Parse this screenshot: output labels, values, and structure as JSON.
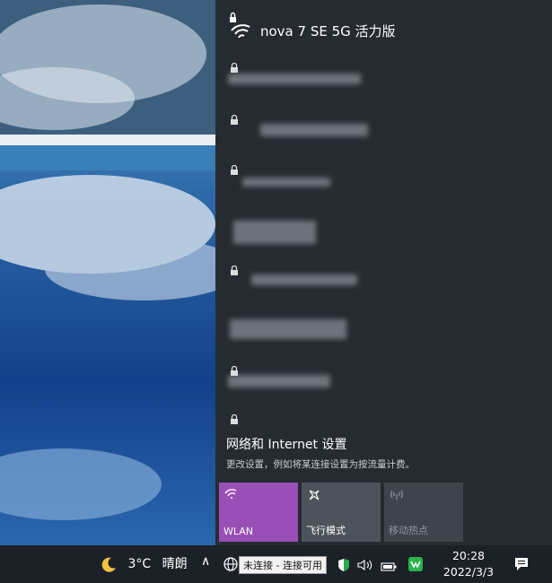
{
  "connected_network": {
    "name": "nova 7 SE 5G 活力版"
  },
  "network_list_rows": 10,
  "settings": {
    "title": "网络和 Internet 设置",
    "subtitle": "更改设置，例如将某连接设置为按流量计费。"
  },
  "quick_actions": [
    {
      "label": "WLAN",
      "icon": "wifi-icon",
      "active": true,
      "color": "#9a4fb7"
    },
    {
      "label": "飞行模式",
      "icon": "airplane-icon",
      "active": false,
      "color": "#4d535b"
    },
    {
      "label": "移动热点",
      "icon": "hotspot-icon",
      "active": false,
      "color": "#3e444b"
    }
  ],
  "taskbar": {
    "weather": {
      "temp": "3°C",
      "condition": "晴朗",
      "icon": "moon-icon"
    },
    "tooltip": "未连接 - 连接可用",
    "time": "20:28",
    "date": "2022/3/3"
  },
  "colors": {
    "accent": "#9a4fb7",
    "panel_bg": "#262b32",
    "taskbar_bg": "#1c2128"
  }
}
